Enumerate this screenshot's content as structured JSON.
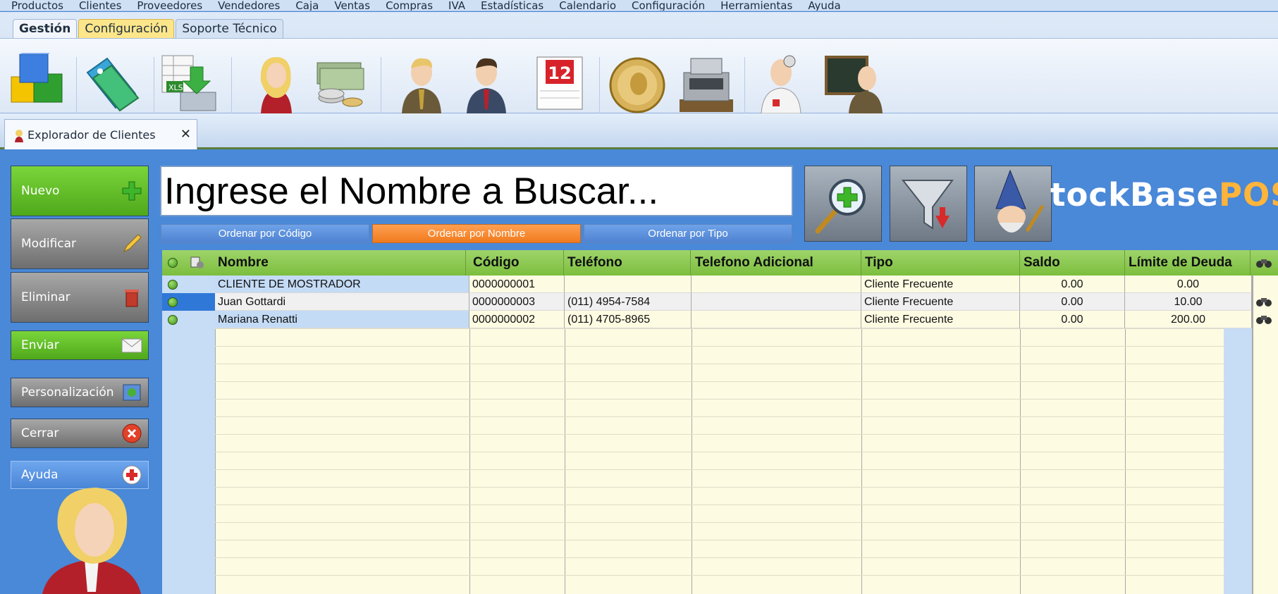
{
  "menu": [
    "Productos",
    "Clientes",
    "Proveedores",
    "Vendedores",
    "Caja",
    "Ventas",
    "Compras",
    "IVA",
    "Estadísticas",
    "Calendario",
    "Configuración",
    "Herramientas",
    "Ayuda"
  ],
  "ribbon": {
    "tabs": [
      "Gestión",
      "Configuración",
      "Soporte Técnico"
    ],
    "icons": [
      "products-cube-icon",
      "price-tags-icon",
      "excel-import-icon",
      "seller-woman-icon",
      "money-coins-icon",
      "client-man-icon",
      "supplier-man-icon",
      "calendar-icon",
      "coin-icon",
      "cash-register-icon",
      "doctor-support-icon",
      "teacher-blackboard-icon"
    ],
    "calendar_day": "12"
  },
  "doc_tab": {
    "label": "Explorador de Clientes",
    "close": "✕"
  },
  "sidebar": {
    "nuevo": "Nuevo",
    "modificar": "Modificar",
    "eliminar": "Eliminar",
    "enviar": "Enviar",
    "personalizacion": "Personalización",
    "cerrar": "Cerrar",
    "ayuda": "Ayuda"
  },
  "search": {
    "placeholder": "Ingrese el Nombre a Buscar..."
  },
  "sort": {
    "codigo": "Ordenar por Código",
    "nombre": "Ordenar por Nombre",
    "tipo": "Ordenar por Tipo"
  },
  "logo": {
    "prefix": "tockBase",
    "suffix": "POS"
  },
  "table": {
    "headers": {
      "nombre": "Nombre",
      "codigo": "Código",
      "telefono": "Teléfono",
      "telefono_adicional": "Telefono Adicional",
      "tipo": "Tipo",
      "saldo": "Saldo",
      "limite": "Límite de Deuda"
    },
    "rows": [
      {
        "nombre": "CLIENTE DE MOSTRADOR",
        "codigo": "0000000001",
        "telefono": "",
        "telefono_adicional": "",
        "tipo": "Cliente Frecuente",
        "saldo": "0.00",
        "limite": "0.00"
      },
      {
        "nombre": "Juan Gottardi",
        "codigo": "0000000003",
        "telefono": "(011) 4954-7584",
        "telefono_adicional": "",
        "tipo": "Cliente Frecuente",
        "saldo": "0.00",
        "limite": "10.00"
      },
      {
        "nombre": "Mariana Renatti",
        "codigo": "0000000002",
        "telefono": "(011) 4705-8965",
        "telefono_adicional": "",
        "tipo": "Cliente Frecuente",
        "saldo": "0.00",
        "limite": "200.00"
      }
    ]
  },
  "colors": {
    "accent_green": "#7cbe3e",
    "sort_active": "#f07a1c",
    "background": "#4a88d8"
  }
}
